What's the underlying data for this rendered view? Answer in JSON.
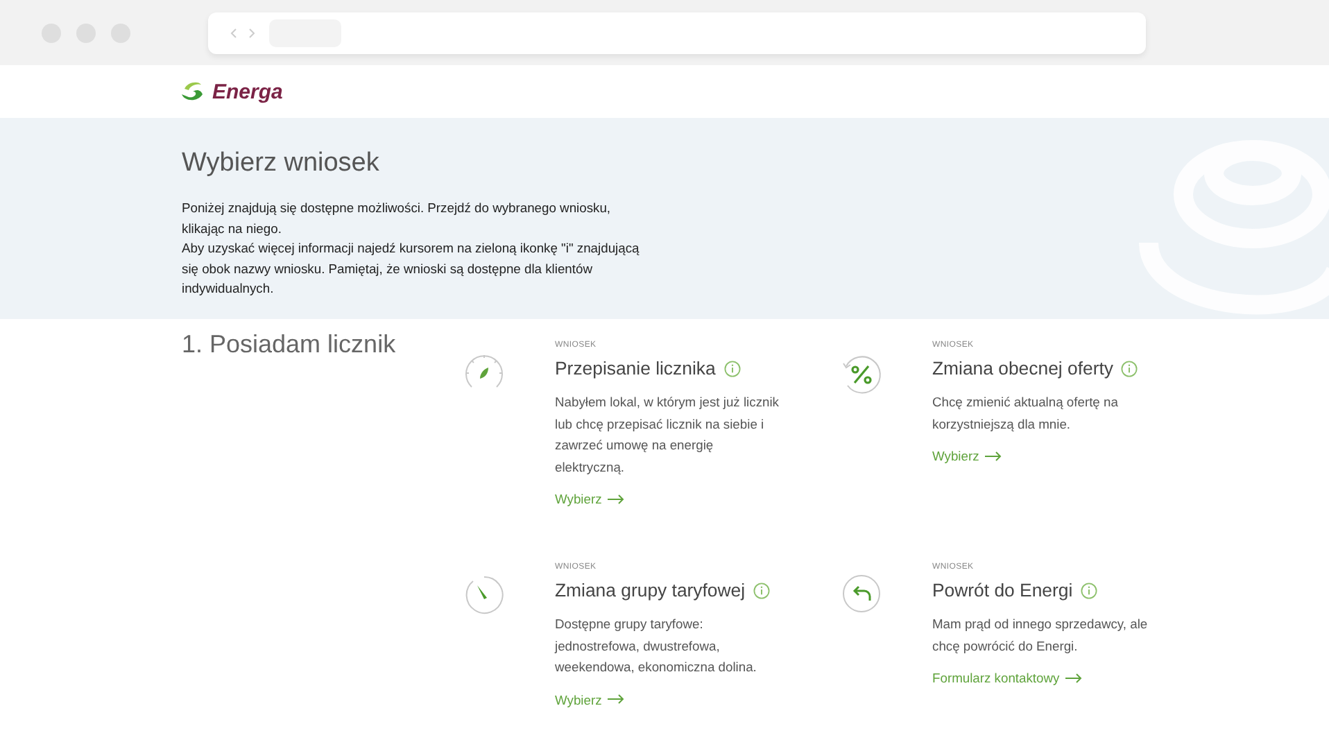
{
  "header": {
    "logo_text": "Energa"
  },
  "hero": {
    "title": "Wybierz wniosek",
    "paragraphs": [
      "Poniżej znajdują się dostępne możliwości. Przejdź do wybranego wniosku, klikając na niego.",
      "Aby uzyskać więcej informacji najedź kursorem na zieloną ikonkę \"i\" znajdującą się obok nazwy wniosku. Pamiętaj, że wnioski są dostępne dla klientów indywidualnych."
    ]
  },
  "section": {
    "title": "1. Posiadam licznik",
    "cards": [
      {
        "kind": "gauge",
        "eyebrow": "WNIOSEK",
        "title": "Przepisanie licznika",
        "description": "Nabyłem lokal, w którym jest już licznik lub chcę przepisać licznik na siebie i zawrzeć umowę na energię elektryczną.",
        "link": "Wybierz"
      },
      {
        "kind": "percent",
        "eyebrow": "WNIOSEK",
        "title": "Zmiana obecnej oferty",
        "description": "Chcę zmienić aktualną ofertę na korzystniejszą dla mnie.",
        "link": "Wybierz"
      },
      {
        "kind": "timer",
        "eyebrow": "WNIOSEK",
        "title": "Zmiana grupy taryfowej",
        "description": "Dostępne grupy taryfowe: jednostrefowa, dwustrefowa, weekendowa, ekonomiczna dolina.",
        "link": "Wybierz"
      },
      {
        "kind": "back",
        "eyebrow": "WNIOSEK",
        "title": "Powrót do Energi",
        "description": "Mam prąd od innego sprzedawcy, ale chcę powrócić do Energi.",
        "link": "Formularz kontaktowy"
      }
    ]
  }
}
